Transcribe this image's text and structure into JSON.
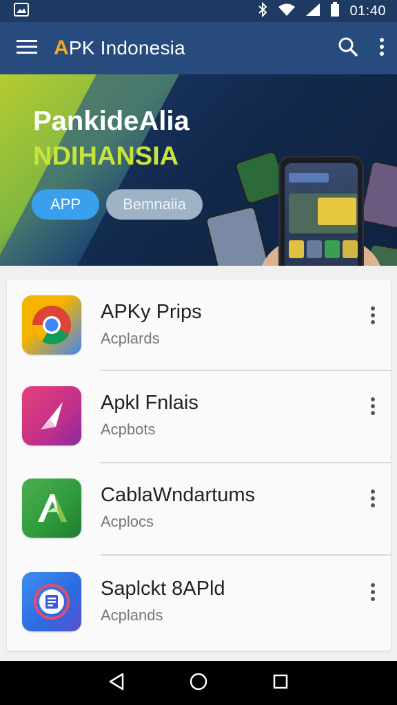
{
  "status_bar": {
    "time": "01:40",
    "icons": [
      "image-icon",
      "bluetooth-icon",
      "wifi-icon",
      "signal-icon",
      "battery-icon"
    ]
  },
  "app_bar": {
    "title_prefix": "A",
    "title_rest": "PK Indonesia",
    "icons": [
      "menu-icon",
      "search-icon",
      "more-vert-icon"
    ],
    "colors": {
      "bar": "#274b7d",
      "accent": "#f0a828"
    }
  },
  "banner": {
    "headline": "PankideAlia",
    "subheadline": "NDIHANSIA",
    "buttons": [
      {
        "label": "APP"
      },
      {
        "label": "Bemnaiia"
      }
    ],
    "colors": {
      "sub": "#c8e33a",
      "primary_pill": "#3aa0ee"
    }
  },
  "apps": [
    {
      "name": "APKy Prips",
      "subtitle": "Acplards",
      "icon": "chrome-icon"
    },
    {
      "name": "Apkl Fnlais",
      "subtitle": "Acpbots",
      "icon": "paper-plane-icon"
    },
    {
      "name": "CablaWndartums",
      "subtitle": "Acplocs",
      "icon": "android-a-icon"
    },
    {
      "name": "Saplckt 8APld",
      "subtitle": "Acplands",
      "icon": "document-icon"
    }
  ],
  "nav_bar": {
    "icons": [
      "back-icon",
      "home-icon",
      "recents-icon"
    ]
  }
}
